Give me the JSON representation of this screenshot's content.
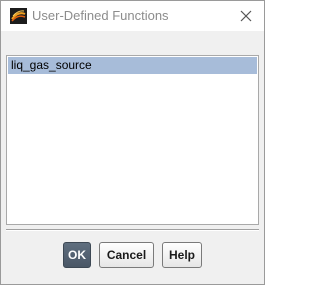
{
  "window": {
    "title": "User-Defined Functions"
  },
  "icons": {
    "app": "fluent-app-icon",
    "close": "close-icon"
  },
  "list": {
    "items": [
      "liq_gas_source"
    ],
    "selected_index": 0
  },
  "buttons": {
    "ok": "OK",
    "cancel": "Cancel",
    "help": "Help"
  },
  "colors": {
    "selection": "#a7bcd9",
    "ok_button": "#4f5d6c",
    "title_text": "#8c8c8c"
  }
}
